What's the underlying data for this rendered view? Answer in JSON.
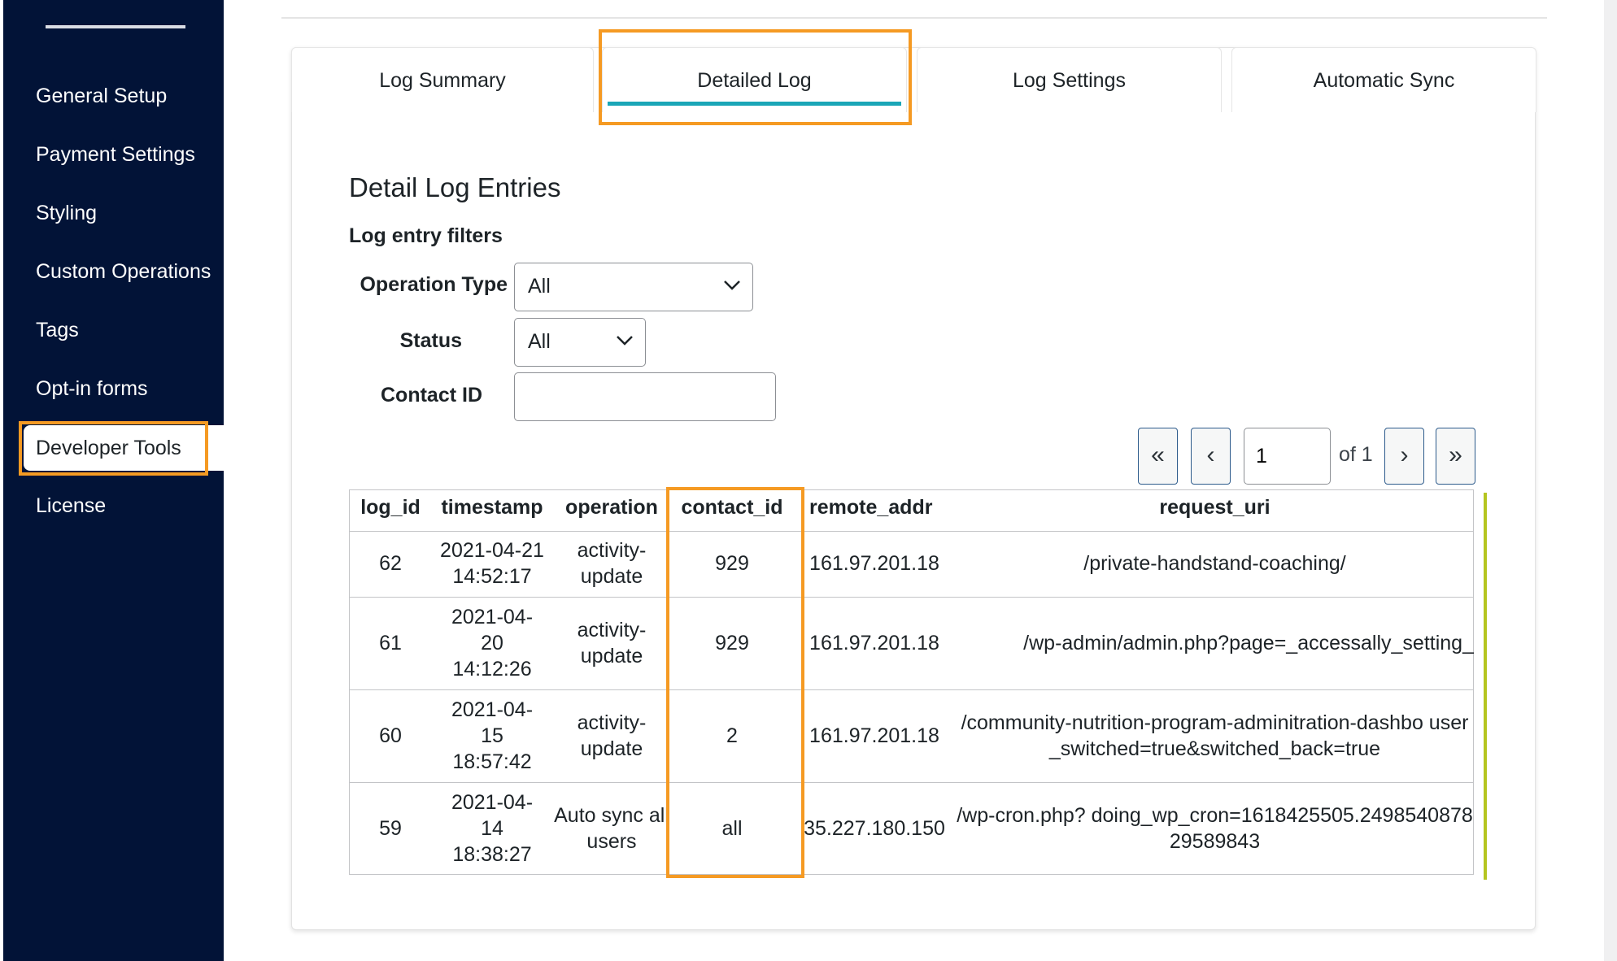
{
  "sidebar": {
    "items": [
      {
        "label": "General Setup"
      },
      {
        "label": "Payment Settings"
      },
      {
        "label": "Styling"
      },
      {
        "label": "Custom Operations"
      },
      {
        "label": "Tags"
      },
      {
        "label": "Opt-in forms"
      },
      {
        "label": "Developer Tools"
      },
      {
        "label": "License"
      }
    ],
    "active_index": 6
  },
  "tabs": [
    {
      "label": "Log Summary"
    },
    {
      "label": "Detailed Log"
    },
    {
      "label": "Log Settings"
    },
    {
      "label": "Automatic Sync"
    }
  ],
  "active_tab": "Detailed Log",
  "section_title": "Detail Log Entries",
  "filters": {
    "heading": "Log entry filters",
    "operation_type": {
      "label": "Operation Type",
      "value": "All"
    },
    "status": {
      "label": "Status",
      "value": "All"
    },
    "contact_id": {
      "label": "Contact ID",
      "value": ""
    }
  },
  "pagination": {
    "first": "«",
    "prev": "‹",
    "next": "›",
    "last": "»",
    "current_page": "1",
    "of_text": "of 1"
  },
  "table": {
    "columns": [
      "log_id",
      "timestamp",
      "operation",
      "contact_id",
      "remote_addr",
      "request_uri"
    ],
    "rows": [
      {
        "log_id": "62",
        "timestamp": "2021-04-21 14:52:17",
        "operation": "activity-update",
        "contact_id": "929",
        "remote_addr": "161.97.201.18",
        "request_uri": "/private-handstand-coaching/"
      },
      {
        "log_id": "61",
        "timestamp": "2021-04-20 14:12:26",
        "operation": "activity-update",
        "contact_id": "929",
        "remote_addr": "161.97.201.18",
        "request_uri": "/wp-admin/admin.php?page=_accessally_setting_"
      },
      {
        "log_id": "60",
        "timestamp": "2021-04-15 18:57:42",
        "operation": "activity-update",
        "contact_id": "2",
        "remote_addr": "161.97.201.18",
        "request_uri": "/community-nutrition-program-adminitration-dashbo user_switched=true&switched_back=true"
      },
      {
        "log_id": "59",
        "timestamp": "2021-04-14 18:38:27",
        "operation": "Auto sync all users",
        "contact_id": "all",
        "remote_addr": "35.227.180.150",
        "request_uri": "/wp-cron.php? doing_wp_cron=1618425505.249854087829589843"
      }
    ]
  },
  "colors": {
    "sidebar_bg": "#021337",
    "highlight": "#f59a23",
    "tab_underline": "#1aa6b7"
  }
}
